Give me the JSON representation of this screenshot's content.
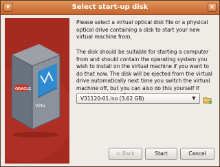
{
  "window": {
    "title": "Select start-up disk"
  },
  "art": {
    "brand": "ORACLE",
    "cube_text": "Virtu"
  },
  "content": {
    "paragraph1": "Please select a virtual optical disk file or a physical optical drive containing a disk to start your new virtual machine from.",
    "paragraph2": "The disk should be suitable for starting a computer from and should contain the operating system you wish to install on the virtual machine if you want to do that now. The disk will be ejected from the virtual drive automatically next time you switch the virtual machine off, but you can also do this yourself if needed using the Devices menu."
  },
  "disk_select": {
    "value": "V31120-01.iso (3.62 GB)"
  },
  "buttons": {
    "back": "< Back",
    "start": "Start",
    "cancel": "Cancel"
  },
  "colors": {
    "titlebar": "#c4622e",
    "art_background": "#a52a1f",
    "dialog_background": "#efebe7"
  },
  "icons": [
    "window-menu-icon",
    "close-icon",
    "dropdown-arrow-icon",
    "folder-icon"
  ]
}
